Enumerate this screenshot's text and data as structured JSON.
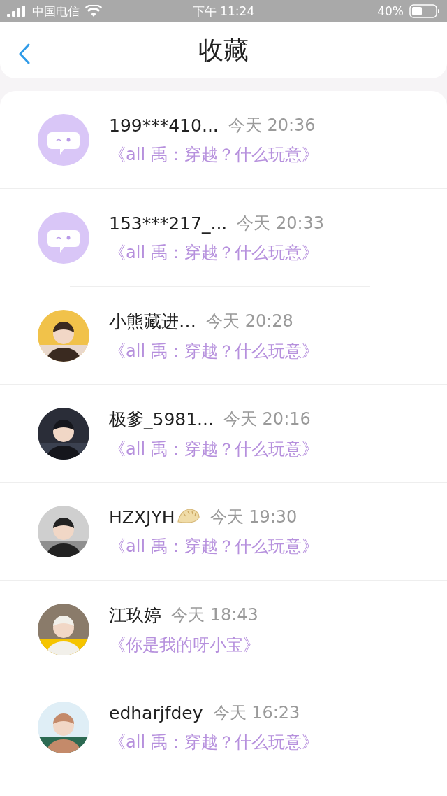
{
  "status_bar": {
    "carrier": "中国电信",
    "time": "下午 11:24",
    "battery": "40%"
  },
  "header": {
    "title": "收藏"
  },
  "items": [
    {
      "kind": "default",
      "name": "199***410...",
      "time": "今天 20:36",
      "work": "《all 禹：穿越？什么玩意》"
    },
    {
      "kind": "default",
      "name": "153***217_...",
      "time": "今天 20:33",
      "work": "《all 禹：穿越？什么玩意》"
    },
    {
      "kind": "picture",
      "name": "小熊藏进…",
      "time": "今天 20:28",
      "work": "《all 禹：穿越？什么玩意》"
    },
    {
      "kind": "picture",
      "name": "极爹_5981...",
      "time": "今天 20:16",
      "work": "《all 禹：穿越？什么玩意》"
    },
    {
      "kind": "picture",
      "name": "HZXJYH",
      "name_badge": {
        "kind": "dumpling"
      },
      "time": "今天 19:30",
      "work": "《all 禹：穿越？什么玩意》"
    },
    {
      "kind": "picture",
      "name": "江玖婷",
      "time": "今天 18:43",
      "work": "《你是我的呀小宝》"
    },
    {
      "kind": "picture",
      "name": "edharjfdey",
      "time": "今天 16:23",
      "work": "《all 禹：穿越？什么玩意》"
    }
  ]
}
